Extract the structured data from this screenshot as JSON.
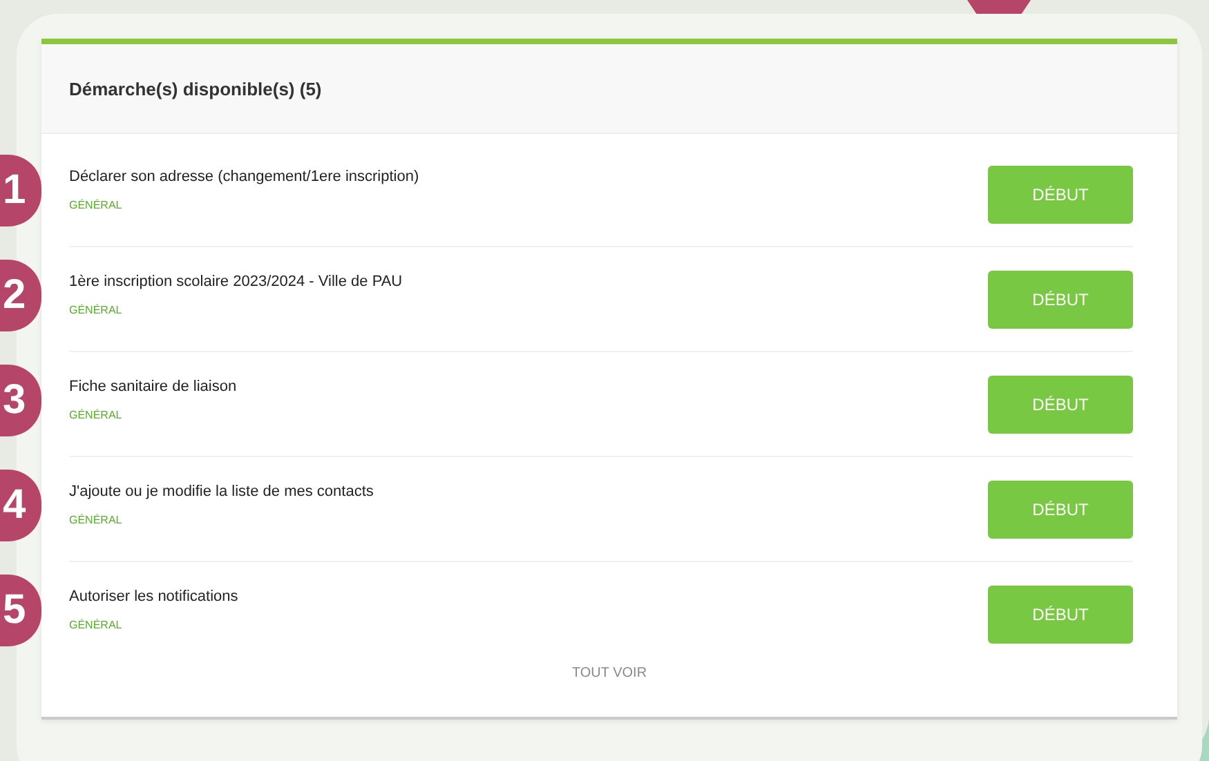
{
  "panel": {
    "title": "Démarche(s) disponible(s) (5)",
    "items": [
      {
        "number": "1",
        "title": "Déclarer son adresse (changement/1ere inscription)",
        "category": "GÉNÉRAL",
        "button": "DÉBUT"
      },
      {
        "number": "2",
        "title": "1ère inscription scolaire 2023/2024 - Ville de PAU",
        "category": "GÉNÉRAL",
        "button": "DÉBUT"
      },
      {
        "number": "3",
        "title": "Fiche sanitaire de liaison",
        "category": "GÉNÉRAL",
        "button": "DÉBUT"
      },
      {
        "number": "4",
        "title": "J'ajoute ou je modifie la liste de mes contacts",
        "category": "GÉNÉRAL",
        "button": "DÉBUT"
      },
      {
        "number": "5",
        "title": "Autoriser les notifications",
        "category": "GÉNÉRAL",
        "button": "DÉBUT"
      }
    ],
    "see_all": "TOUT VOIR"
  }
}
